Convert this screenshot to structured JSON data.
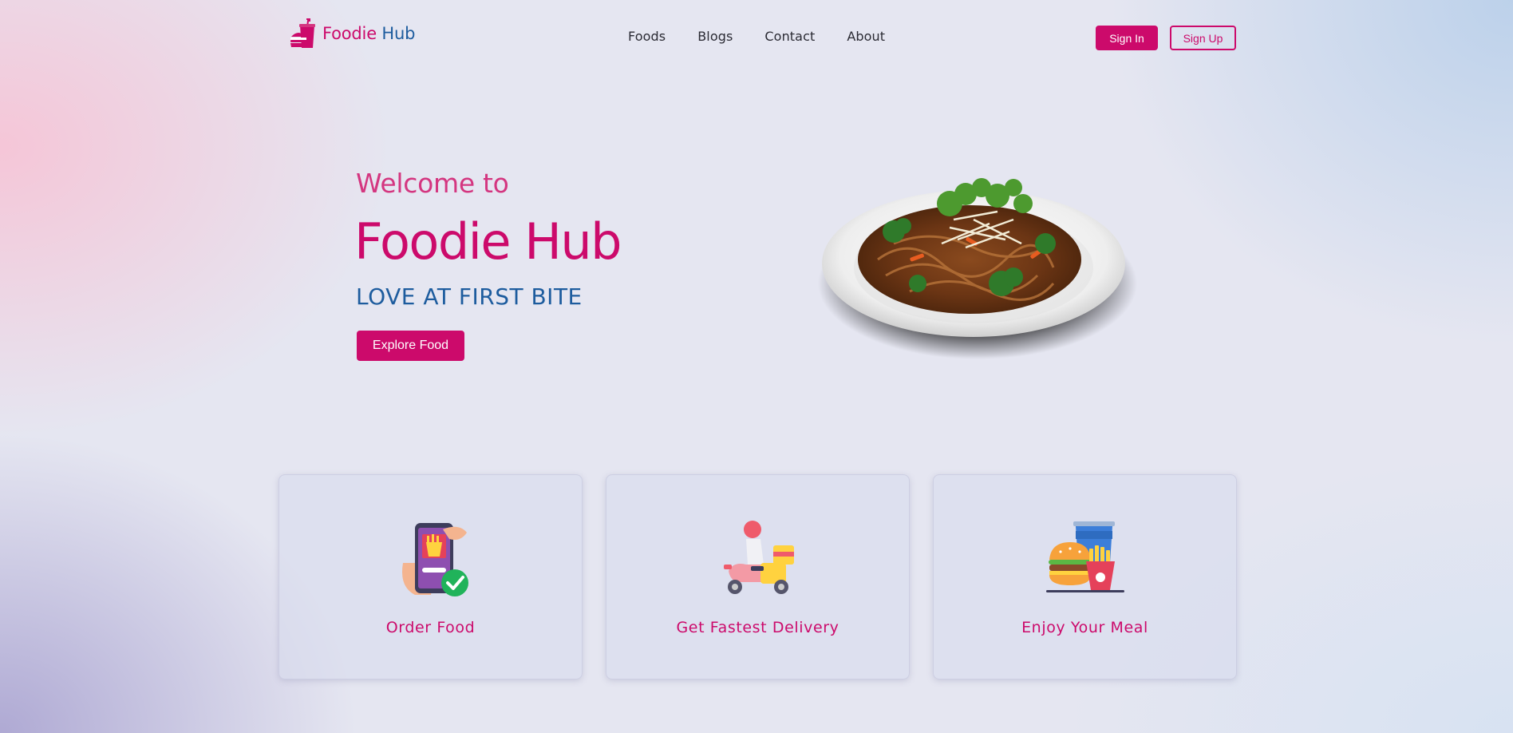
{
  "header": {
    "logo_part1": "Foodie",
    "logo_part2": "Hub",
    "nav": [
      "Foods",
      "Blogs",
      "Contact",
      "About"
    ],
    "signin_label": "Sign In",
    "signup_label": "Sign Up"
  },
  "hero": {
    "welcome": "Welcome to",
    "title": "Foodie Hub",
    "tagline": "LOVE AT FIRST BITE",
    "cta_label": "Explore Food"
  },
  "features": [
    {
      "label": "Order Food",
      "icon": "phone-order-icon"
    },
    {
      "label": "Get Fastest Delivery",
      "icon": "delivery-scooter-icon"
    },
    {
      "label": "Enjoy Your Meal",
      "icon": "burger-meal-icon"
    }
  ],
  "colors": {
    "brand_pink": "#cc0a6b",
    "brand_blue": "#1d5c9e"
  }
}
